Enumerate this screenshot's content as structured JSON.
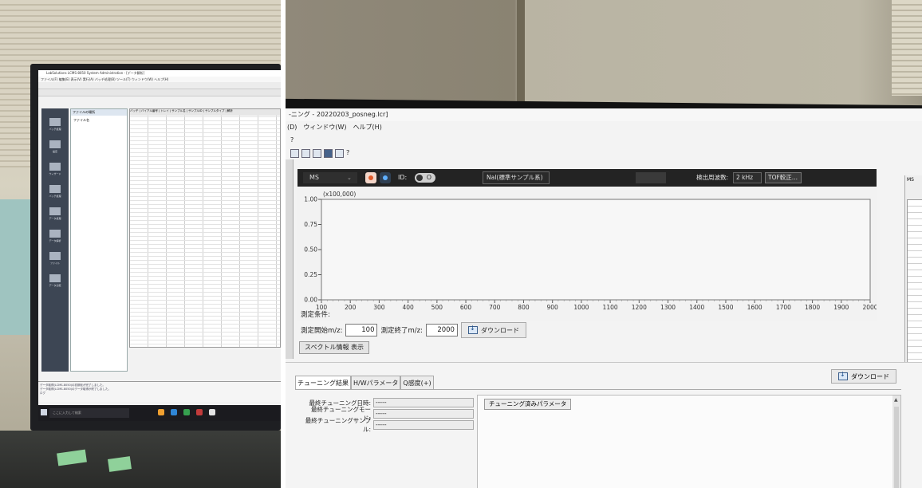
{
  "left_photo": {
    "app_title": "LabSolutions  LCMS-8050 System Administration - [データ解析]",
    "menu": "ファイル(F)  編集(E)  表示(V)  実行(A)  バッチ処理(B)  ツール(T)  ウィンドウ(W)  ヘルプ(H)",
    "sidebar_items": [
      "バッチ処理",
      "設定",
      "ウィザード",
      "バッチ処理",
      "データ処理",
      "データ解析",
      "ファイル",
      "データ比較"
    ],
    "tree_header": "ファイルの場所",
    "tree_item": "ファイル名",
    "grid_header": "バッチ | バイアル番号 | トレイ | サンプル名 | サンプルID | サンプルタイプ | 解析",
    "message_lines": [
      "データ取得(LCMS-8050)の初期化が完了しました。",
      "データ取得(LCMS-8050)のデータ取得が終了しました。",
      "ログ"
    ],
    "taskbar_search": "ここに入力して検索",
    "taskbar_colors": [
      "#f0a030",
      "#2f86d6",
      "#36a04f",
      "#c23b3b",
      "#e3e3e3"
    ]
  },
  "right_photo": {
    "title": "-ニング - 20220203_posneg.lcr]",
    "menu": [
      "(D)",
      "ウィンドウ(W)",
      "ヘルプ(H)"
    ],
    "toolbar_question": "?",
    "toolbar2_question": "?",
    "ms_bar": {
      "mode": "MS",
      "id_label": "ID:",
      "toggle_state": "O",
      "sample_select": "NaI(標準サンプル系)",
      "freq_label": "検出周波数:",
      "freq_value": "2 kHz",
      "tof_button": "TOF較正..."
    },
    "chart_data": {
      "type": "line",
      "title": "",
      "y_multiplier": "(x100,000)",
      "xlabel": "",
      "ylabel": "",
      "xlim": [
        100,
        2000
      ],
      "ylim": [
        0,
        1.0
      ],
      "x_ticks": [
        100,
        200,
        300,
        400,
        500,
        600,
        700,
        800,
        900,
        1000,
        1100,
        1200,
        1300,
        1400,
        1500,
        1600,
        1700,
        1800,
        1900,
        2000
      ],
      "y_tick_labels": [
        "1.00",
        "0.75",
        "0.50",
        "0.25",
        "0.00"
      ],
      "series": []
    },
    "measurement": {
      "conditions_label": "測定条件:",
      "start_label": "測定開始m/z:",
      "start_value": "100",
      "end_label": "測定終了m/z:",
      "end_value": "2000",
      "download_button": "ダウンロード",
      "spectrum_info_button": "スペクトル情報 表示"
    },
    "tuning": {
      "tabs": [
        "チューニング結果",
        "H/Wパラメータ",
        "Q感度(+)"
      ],
      "download_button": "ダウンロード",
      "last_date_label": "最終チューニング日時:",
      "last_date_value": "-----",
      "last_mode_label": "最終チューニングモード:",
      "last_mode_value": "-----",
      "last_sample_label": "最終チューニングサンプル:",
      "last_sample_value": "-----",
      "tuned_params_button": "チューニング済みパラメータ"
    },
    "side_panel_label": "MS"
  }
}
